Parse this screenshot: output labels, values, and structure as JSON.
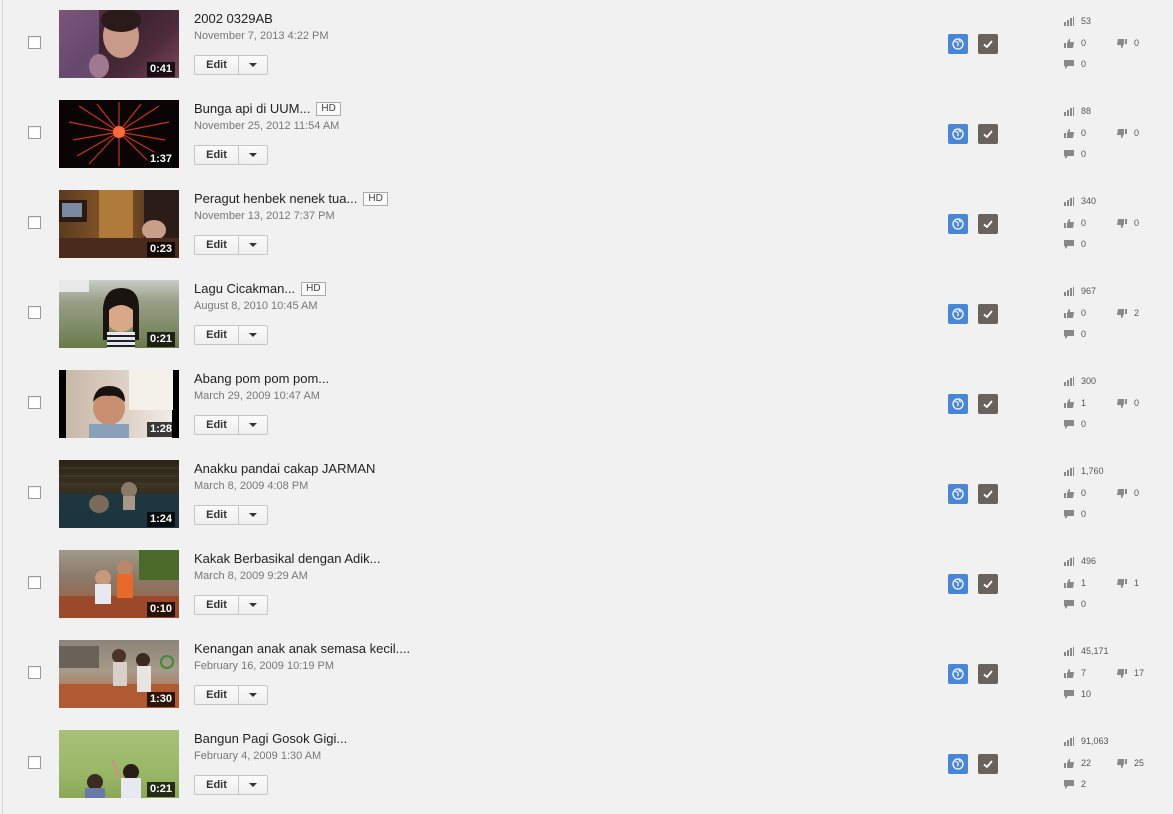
{
  "edit_label": "Edit",
  "colors": {
    "privacy_public": "#4a86d8",
    "published": "#6a625c",
    "background": "#f1f1f1"
  },
  "icons": {
    "privacy": "globe-icon",
    "published": "checkmark-icon",
    "views": "bar-chart-icon",
    "likes": "thumbs-up-icon",
    "dislikes": "thumbs-down-icon",
    "comments": "comment-icon",
    "menu": "chevron-down-icon"
  },
  "videos": [
    {
      "title": "2002 0329AB",
      "hd": false,
      "date": "November 7, 2013 4:22 PM",
      "duration": "0:41",
      "views": "53",
      "likes": "0",
      "dislikes": "0",
      "comments": "0"
    },
    {
      "title": "Bunga api di UUM...",
      "hd": true,
      "hd_label": "HD",
      "date": "November 25, 2012 11:54 AM",
      "duration": "1:37",
      "views": "88",
      "likes": "0",
      "dislikes": "0",
      "comments": "0"
    },
    {
      "title": "Peragut henbek nenek tua...",
      "hd": true,
      "hd_label": "HD",
      "date": "November 13, 2012 7:37 PM",
      "duration": "0:23",
      "views": "340",
      "likes": "0",
      "dislikes": "0",
      "comments": "0"
    },
    {
      "title": "Lagu Cicakman...",
      "hd": true,
      "hd_label": "HD",
      "date": "August 8, 2010 10:45 AM",
      "duration": "0:21",
      "views": "967",
      "likes": "0",
      "dislikes": "2",
      "comments": "0"
    },
    {
      "title": "Abang pom pom pom...",
      "hd": false,
      "date": "March 29, 2009 10:47 AM",
      "duration": "1:28",
      "views": "300",
      "likes": "1",
      "dislikes": "0",
      "comments": "0"
    },
    {
      "title": "Anakku pandai cakap JARMAN",
      "hd": false,
      "date": "March 8, 2009 4:08 PM",
      "duration": "1:24",
      "views": "1,760",
      "likes": "0",
      "dislikes": "0",
      "comments": "0"
    },
    {
      "title": "Kakak Berbasikal dengan Adik...",
      "hd": false,
      "date": "March 8, 2009 9:29 AM",
      "duration": "0:10",
      "views": "496",
      "likes": "1",
      "dislikes": "1",
      "comments": "0"
    },
    {
      "title": "Kenangan anak anak semasa kecil....",
      "hd": false,
      "date": "February 16, 2009 10:19 PM",
      "duration": "1:30",
      "views": "45,171",
      "likes": "7",
      "dislikes": "17",
      "comments": "10"
    },
    {
      "title": "Bangun Pagi Gosok Gigi...",
      "hd": false,
      "date": "February 4, 2009 1:30 AM",
      "duration": "0:21",
      "views": "91,063",
      "likes": "22",
      "dislikes": "25",
      "comments": "2"
    }
  ]
}
